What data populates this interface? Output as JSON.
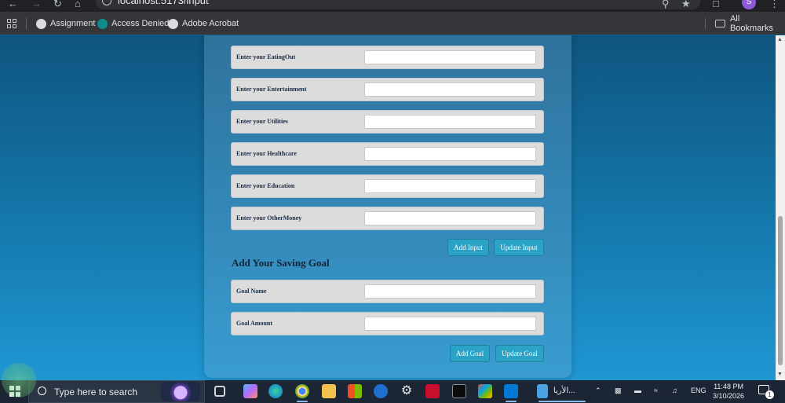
{
  "browser": {
    "url": "localhost:5173/input",
    "profile_initial": "S",
    "bookmarks": [
      {
        "label": "Assignment"
      },
      {
        "label": "Access Denied"
      },
      {
        "label": "Adobe Acrobat"
      }
    ],
    "all_bookmarks_label": "All Bookmarks"
  },
  "form": {
    "expense_rows": [
      {
        "label": "Enter your EatingOut",
        "value": ""
      },
      {
        "label": "Enter your Entertainment",
        "value": ""
      },
      {
        "label": "Enter your Utilities",
        "value": ""
      },
      {
        "label": "Enter your Healthcare",
        "value": ""
      },
      {
        "label": "Enter your Education",
        "value": ""
      },
      {
        "label": "Enter your OtherMoney",
        "value": ""
      }
    ],
    "add_input_label": "Add Input",
    "update_input_label": "Update Input",
    "saving_goal_title": "Add Your Saving Goal",
    "goal_rows": [
      {
        "label": "Goal Name",
        "value": ""
      },
      {
        "label": "Goal Amount",
        "value": ""
      }
    ],
    "add_goal_label": "Add Goal",
    "update_goal_label": "Update Goal"
  },
  "taskbar": {
    "search_placeholder": "Type here to search",
    "app_label": "الأريا...",
    "language": "ENG",
    "time": "11:48 PM",
    "date": "3/10/2026",
    "notification_count": "1"
  },
  "colors": {
    "button": "#2aa3c6",
    "row_background": "#dcdcdc",
    "page_gradient_top": "#0f5580",
    "page_gradient_bottom": "#1f97d3"
  }
}
